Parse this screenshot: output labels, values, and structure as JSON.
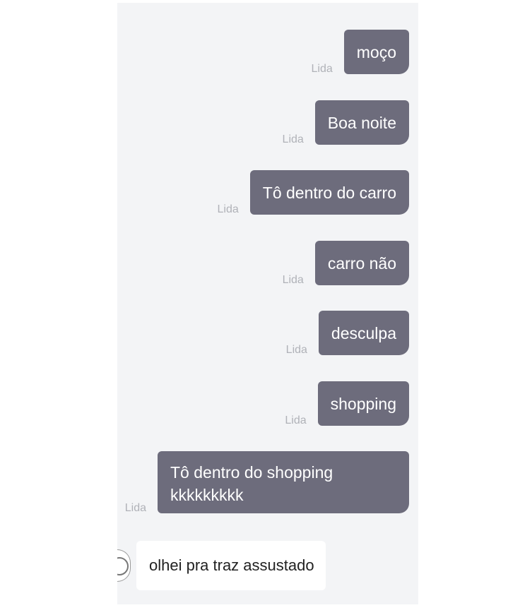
{
  "chat": {
    "messages": [
      {
        "sender": "Lida",
        "text": "moço"
      },
      {
        "sender": "Lida",
        "text": "Boa noite"
      },
      {
        "sender": "Lida",
        "text": "Tô dentro do carro"
      },
      {
        "sender": "Lida",
        "text": "carro não"
      },
      {
        "sender": "Lida",
        "text": "desculpa"
      },
      {
        "sender": "Lida",
        "text": "shopping"
      },
      {
        "sender": "Lida",
        "text": "Tô dentro do shopping kkkkkkkkk"
      }
    ],
    "incoming": {
      "text": "olhei pra traz assustado"
    }
  }
}
